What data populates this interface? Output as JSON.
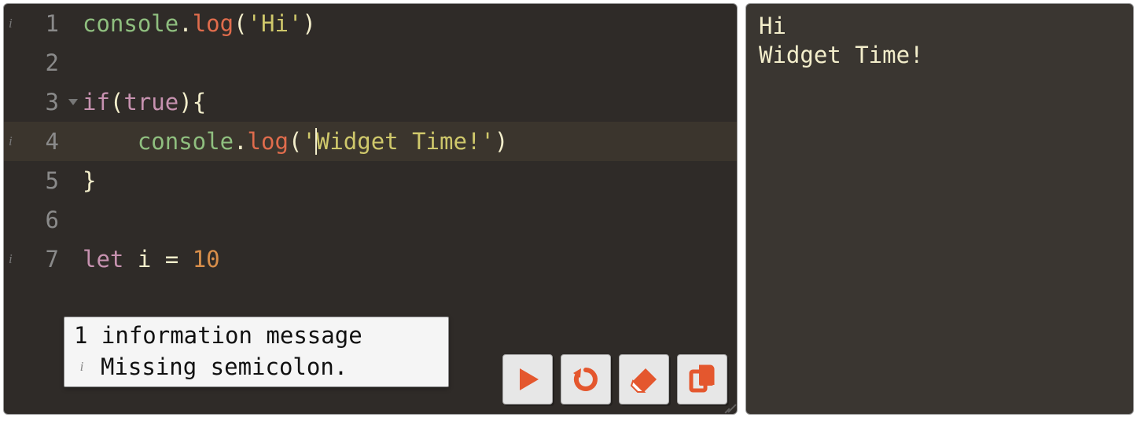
{
  "editor": {
    "active_line": 4,
    "cursor_col_after": "'",
    "lines": [
      {
        "n": 1,
        "info": true,
        "fold": false,
        "tokens": [
          [
            "obj",
            "console"
          ],
          [
            "dot",
            "."
          ],
          [
            "fn",
            "log"
          ],
          [
            "paren",
            "("
          ],
          [
            "str",
            "'Hi'"
          ],
          [
            "paren",
            ")"
          ]
        ]
      },
      {
        "n": 2,
        "info": false,
        "fold": false,
        "tokens": []
      },
      {
        "n": 3,
        "info": false,
        "fold": true,
        "tokens": [
          [
            "kw",
            "if"
          ],
          [
            "paren",
            "("
          ],
          [
            "bool",
            "true"
          ],
          [
            "paren",
            ")"
          ],
          [
            "brace",
            "{"
          ]
        ]
      },
      {
        "n": 4,
        "info": true,
        "fold": false,
        "indent": "    ",
        "tokens": [
          [
            "obj",
            "console"
          ],
          [
            "dot",
            "."
          ],
          [
            "fn",
            "log"
          ],
          [
            "paren",
            "("
          ],
          [
            "str",
            "'"
          ],
          [
            "cursor",
            ""
          ],
          [
            "str",
            "Widget Time!'"
          ],
          [
            "paren",
            ")"
          ]
        ]
      },
      {
        "n": 5,
        "info": false,
        "fold": false,
        "tokens": [
          [
            "brace",
            "}"
          ]
        ]
      },
      {
        "n": 6,
        "info": false,
        "fold": false,
        "tokens": []
      },
      {
        "n": 7,
        "info": true,
        "fold": false,
        "tokens": [
          [
            "kw",
            "let"
          ],
          [
            "var",
            " i "
          ],
          [
            "op",
            "= "
          ],
          [
            "num",
            "10"
          ]
        ]
      }
    ]
  },
  "message": {
    "title": "1 information message",
    "detail": "Missing semicolon."
  },
  "toolbar": {
    "run": "Run",
    "reset": "Reset",
    "clear": "Clear",
    "copy": "Copy"
  },
  "output": "Hi\nWidget Time!"
}
